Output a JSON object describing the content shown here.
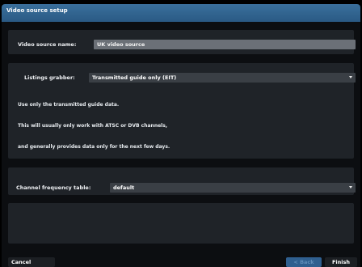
{
  "window": {
    "title": "Video source setup"
  },
  "source_name": {
    "label": "Video source name:",
    "value": "UK video source"
  },
  "listings": {
    "label": "Listings grabber:",
    "selected": "Transmitted guide only (EIT)",
    "description": [
      "Use only the transmitted guide data.",
      "This will usually only work with ATSC or DVB channels,",
      "and generally provides data only for the next few days."
    ]
  },
  "frequency": {
    "label": "Channel frequency table:",
    "selected": "default"
  },
  "buttons": {
    "cancel": "Cancel",
    "back": "< Back",
    "finish": "Finish"
  }
}
